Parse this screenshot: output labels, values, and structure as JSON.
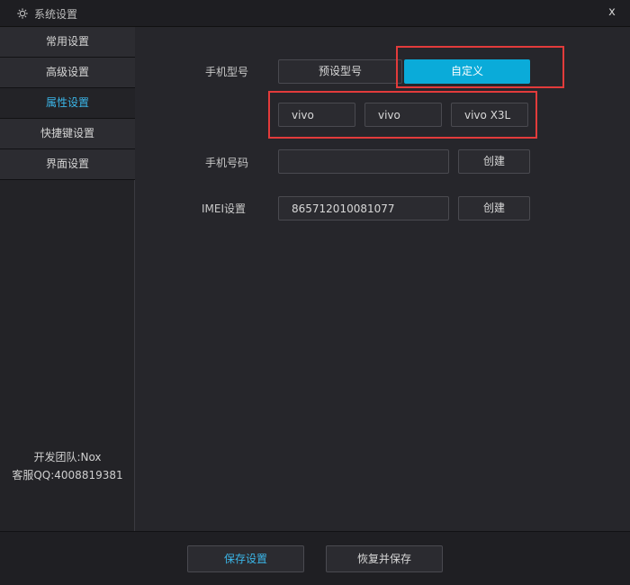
{
  "window": {
    "title": "系统设置",
    "close_label": "x"
  },
  "sidebar": {
    "items": [
      {
        "label": "常用设置"
      },
      {
        "label": "高级设置"
      },
      {
        "label": "属性设置"
      },
      {
        "label": "快捷键设置"
      },
      {
        "label": "界面设置"
      }
    ],
    "active_item": "属性设置",
    "dev_team": "开发团队:Nox",
    "support_qq": "客服QQ:4008819381"
  },
  "model": {
    "label": "手机型号",
    "preset_label": "预设型号",
    "custom_label": "自定义",
    "selected": "自定义",
    "brand": "vivo",
    "manufacturer": "vivo",
    "model_name": "vivo X3L"
  },
  "phone": {
    "label": "手机号码",
    "value": "",
    "create_label": "创建"
  },
  "imei": {
    "label": "IMEI设置",
    "value": "865712010081077",
    "create_label": "创建"
  },
  "footer": {
    "save_label": "保存设置",
    "restore_label": "恢复并保存"
  },
  "colors": {
    "accent": "#0aabd9",
    "active_text": "#3bb6e8",
    "highlight_box": "#e23b3b"
  }
}
